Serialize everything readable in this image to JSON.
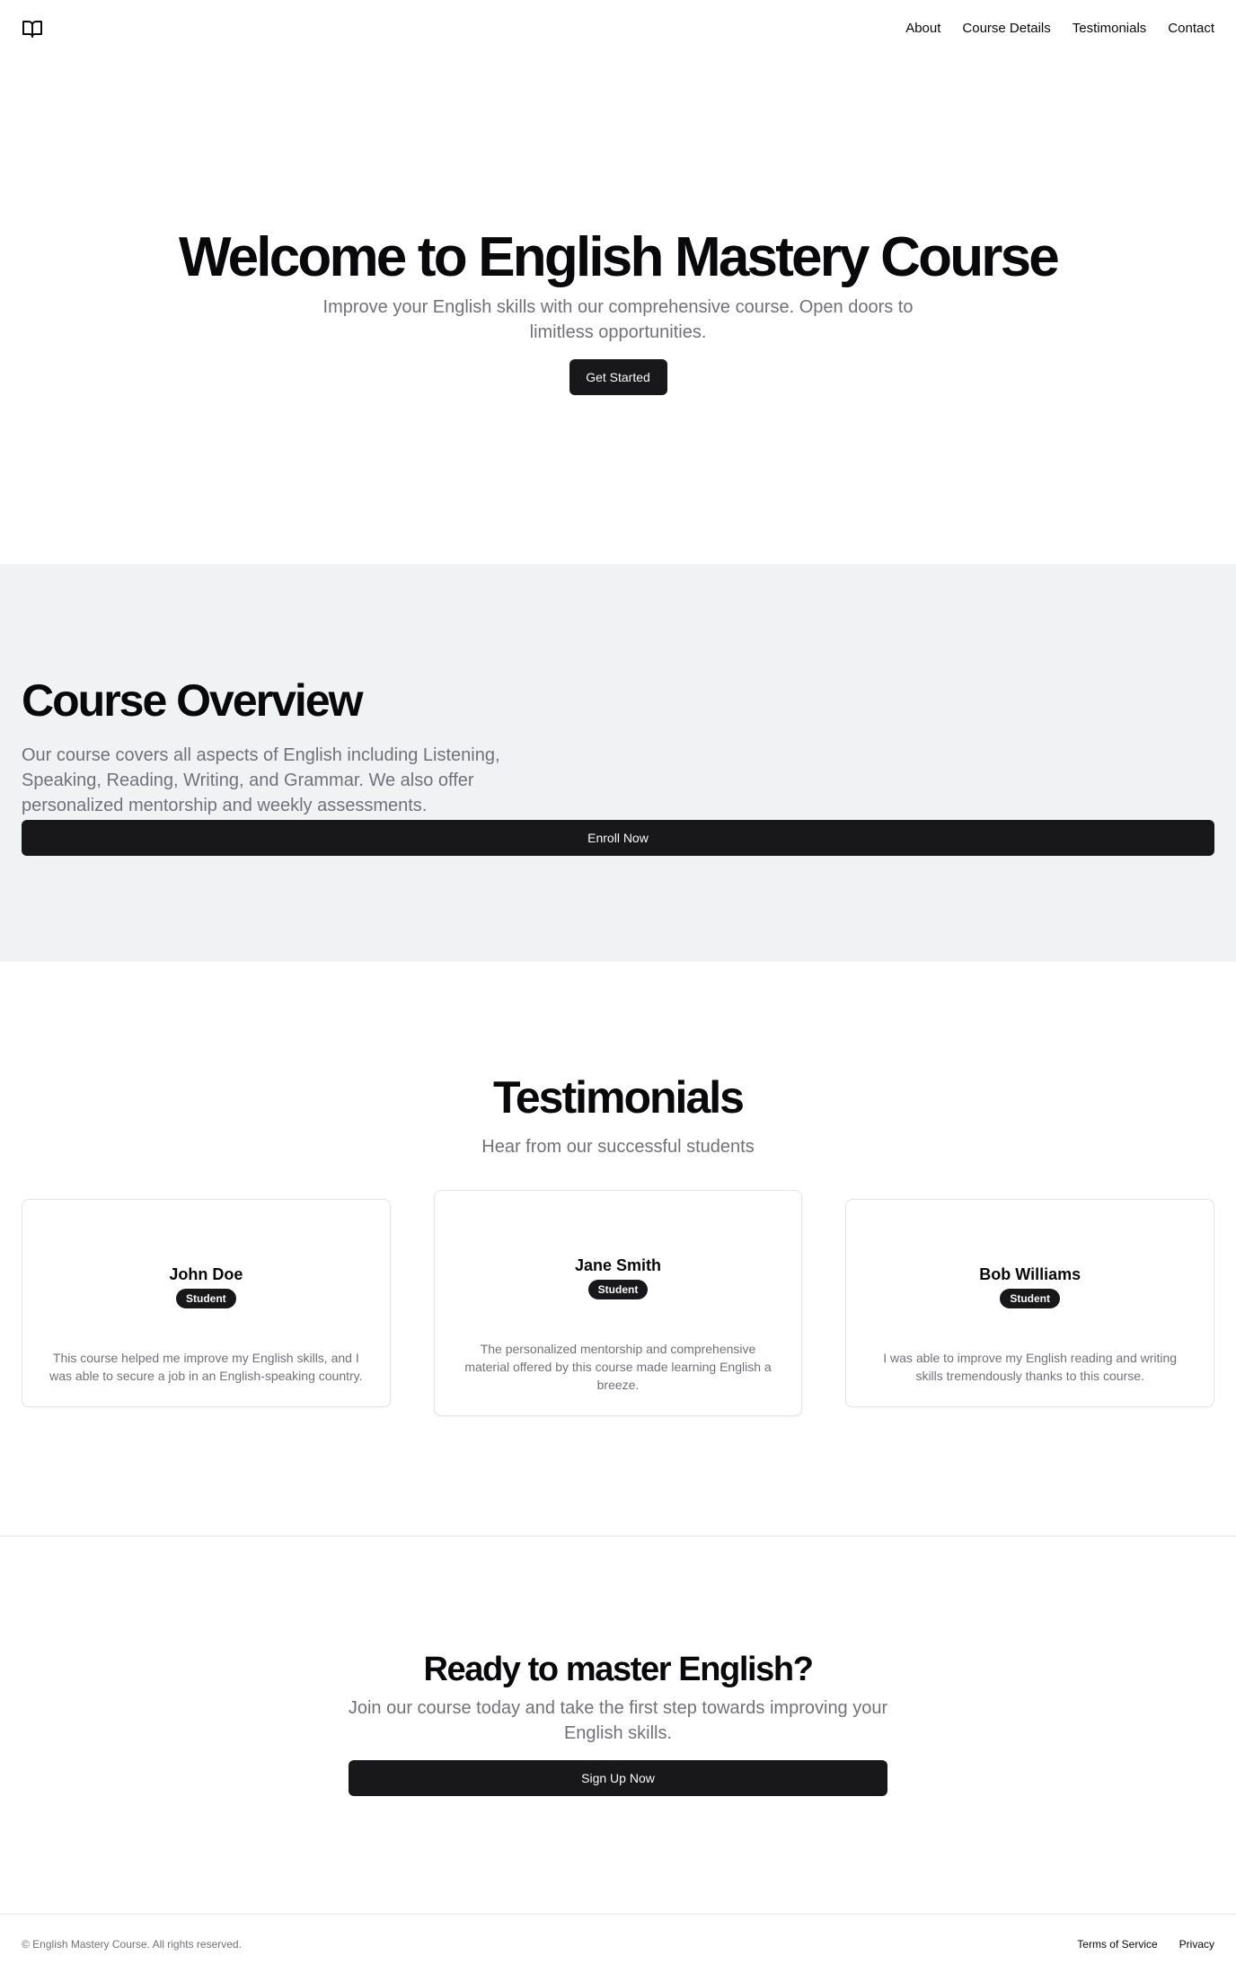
{
  "header": {
    "logo_icon": "book-open-icon",
    "nav": [
      {
        "label": "About"
      },
      {
        "label": "Course Details"
      },
      {
        "label": "Testimonials"
      },
      {
        "label": "Contact"
      }
    ]
  },
  "hero": {
    "title": "Welcome to English Mastery Course",
    "subtitle": "Improve your English skills with our comprehensive course. Open doors to limitless opportunities.",
    "button": "Get Started"
  },
  "overview": {
    "title": "Course Overview",
    "text": "Our course covers all aspects of English including Listening, Speaking, Reading, Writing, and Grammar. We also offer personalized mentorship and weekly assessments.",
    "button": "Enroll Now"
  },
  "testimonials": {
    "title": "Testimonials",
    "subtitle": "Hear from our successful students",
    "items": [
      {
        "name": "John Doe",
        "badge": "Student",
        "quote": "This course helped me improve my English skills, and I was able to secure a job in an English-speaking country."
      },
      {
        "name": "Jane Smith",
        "badge": "Student",
        "quote": "The personalized mentorship and comprehensive material offered by this course made learning English a breeze."
      },
      {
        "name": "Bob Williams",
        "badge": "Student",
        "quote": "I was able to improve my English reading and writing skills tremendously thanks to this course."
      }
    ]
  },
  "cta": {
    "title": "Ready to master English?",
    "text": "Join our course today and take the first step towards improving your English skills.",
    "button": "Sign Up Now"
  },
  "footer": {
    "copyright": "© English Mastery Course. All rights reserved.",
    "links": [
      {
        "label": "Terms of Service"
      },
      {
        "label": "Privacy"
      }
    ]
  },
  "colors": {
    "primary": "#18181b",
    "muted_text": "#71717a",
    "section_bg": "#f1f2f4",
    "border": "#e4e4e7"
  }
}
